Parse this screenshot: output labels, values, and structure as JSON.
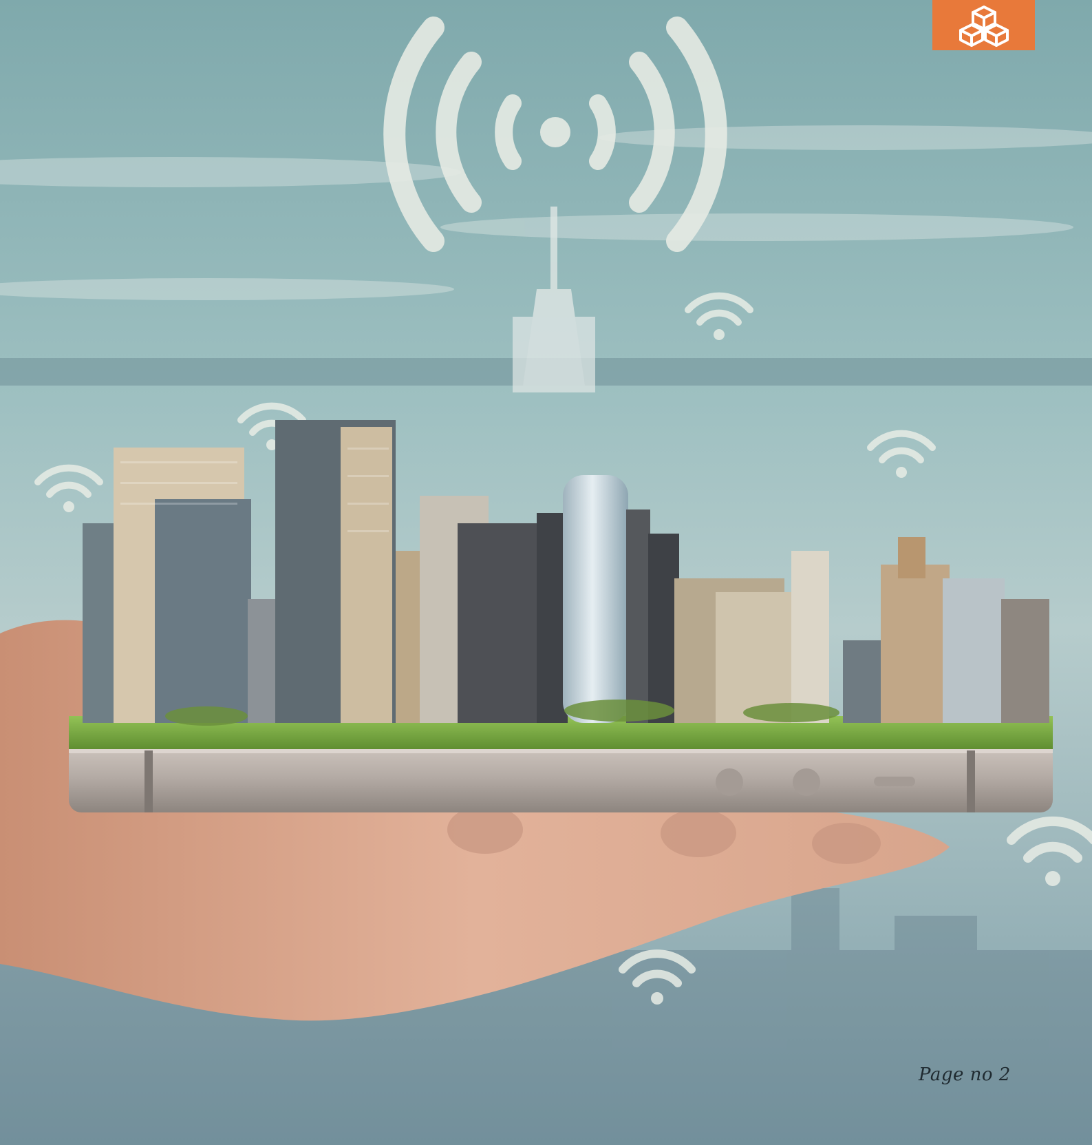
{
  "page": {
    "page_number_label": "Page no 2"
  },
  "brand_badge": {
    "icon": "cubes-logo-icon",
    "color": "#e8793a"
  },
  "scene": {
    "icons": [
      "wifi-broadcast-icon",
      "wifi-signal-icon"
    ],
    "colors": {
      "sky": "#8fb8bc",
      "grass": "#7fb542",
      "phone": "#b9b0aa",
      "hand": "#d9a88c",
      "signal": "#e6ebe4"
    }
  }
}
